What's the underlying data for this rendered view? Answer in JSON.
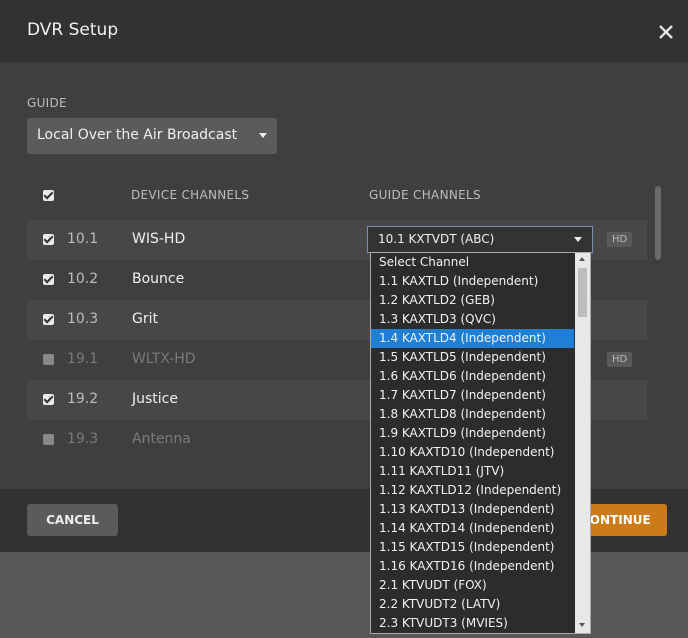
{
  "window": {
    "title": "DVR Setup"
  },
  "guide": {
    "label": "GUIDE",
    "selected": "Local Over the Air Broadcast"
  },
  "table": {
    "col_device": "DEVICE CHANNELS",
    "col_guide": "GUIDE CHANNELS",
    "rows": [
      {
        "number": "10.1",
        "name": "WIS-HD",
        "checked": true,
        "hd": "HD"
      },
      {
        "number": "10.2",
        "name": "Bounce",
        "checked": true,
        "hd": ""
      },
      {
        "number": "10.3",
        "name": "Grit",
        "checked": true,
        "hd": ""
      },
      {
        "number": "19.1",
        "name": "WLTX-HD",
        "checked": false,
        "hd": "HD"
      },
      {
        "number": "19.2",
        "name": "Justice",
        "checked": true,
        "hd": ""
      },
      {
        "number": "19.3",
        "name": "Antenna",
        "checked": false,
        "hd": ""
      }
    ],
    "guide_select_value": "10.1 KXTVDT (ABC)"
  },
  "dropdown": {
    "options": [
      "Select Channel",
      "1.1 KAXTLD (Independent)",
      "1.2 KAXTLD2 (GEB)",
      "1.3 KAXTLD3 (QVC)",
      "1.4 KAXTLD4 (Independent)",
      "1.5 KAXTLD5 (Independent)",
      "1.6 KAXTLD6 (Independent)",
      "1.7 KAXTLD7 (Independent)",
      "1.8 KAXTLD8 (Independent)",
      "1.9 KAXTLD9 (Independent)",
      "1.10 KAXTD10 (Independent)",
      "1.11 KAXTLD11 (JTV)",
      "1.12 KAXTLD12 (Independent)",
      "1.13 KAXTD13 (Independent)",
      "1.14 KAXTD14 (Independent)",
      "1.15 KAXTD15 (Independent)",
      "1.16 KAXTD16 (Independent)",
      "2.1 KTVUDT (FOX)",
      "2.2 KTVUDT2 (LATV)",
      "2.3 KTVUDT3 (MVIES)"
    ],
    "highlighted": "1.4 KAXTLD4 (Independent)"
  },
  "footer": {
    "cancel": "CANCEL",
    "continue": "CONTINUE"
  },
  "colors": {
    "accent": "#cc7b19",
    "highlight": "#1e7fd4"
  },
  "icons": {
    "close": "close-icon",
    "caret": "chevron-down-icon"
  }
}
